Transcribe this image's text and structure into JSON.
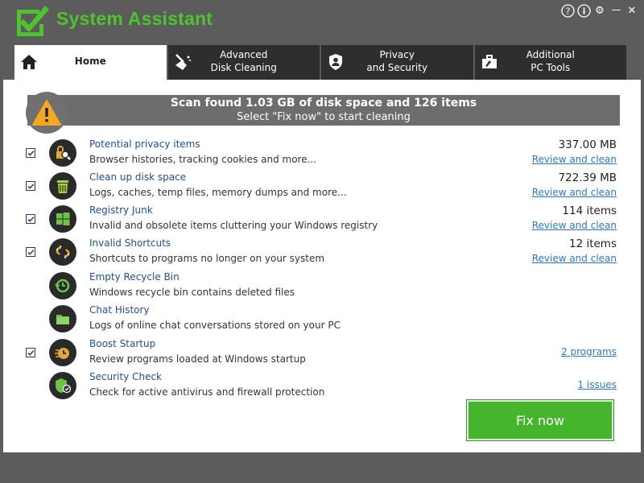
{
  "app": {
    "title": "System Assistant"
  },
  "window_controls": [
    {
      "name": "help-icon",
      "glyph": "?"
    },
    {
      "name": "info-icon",
      "glyph": "i"
    },
    {
      "name": "gear-icon",
      "glyph": "⚙"
    },
    {
      "name": "minimize-icon",
      "glyph": "—"
    },
    {
      "name": "close-icon",
      "glyph": "✕"
    }
  ],
  "tabs": [
    {
      "icon": "home-icon",
      "line1": "Home",
      "line2": "",
      "active": true
    },
    {
      "icon": "broom-icon",
      "line1": "Advanced",
      "line2": "Disk Cleaning",
      "active": false
    },
    {
      "icon": "shield-person-icon",
      "line1": "Privacy",
      "line2": "and Security",
      "active": false
    },
    {
      "icon": "toolbox-icon",
      "line1": "Additional",
      "line2": "PC Tools",
      "active": false
    }
  ],
  "banner": {
    "title": "Scan found 1.03 GB of disk space and 126 items",
    "subtitle": "Select \"Fix now\" to start cleaning"
  },
  "items": [
    {
      "title": "Potential privacy items",
      "desc": "Browser histories, tracking cookies and more...",
      "value": "337.00 MB",
      "link": "Review and clean",
      "checked": true,
      "icon": "padlock-magnifier-icon"
    },
    {
      "title": "Clean up disk space",
      "desc": "Logs, caches, temp files, memory dumps and more...",
      "value": "722.39 MB",
      "link": "Review and clean",
      "checked": true,
      "icon": "trash-bin-icon"
    },
    {
      "title": "Registry Junk",
      "desc": "Invalid and obsolete items cluttering your Windows registry",
      "value": "114 items",
      "link": "Review and clean",
      "checked": true,
      "icon": "windows-icon"
    },
    {
      "title": "Invalid Shortcuts",
      "desc": "Shortcuts to programs no longer on your system",
      "value": "12 items",
      "link": "Review and clean",
      "checked": true,
      "icon": "broken-link-icon"
    },
    {
      "title": "Empty Recycle Bin",
      "desc": "Windows recycle bin contains deleted files",
      "value": "",
      "link": "",
      "checked": false,
      "icon": "recycle-clock-icon"
    },
    {
      "title": "Chat History",
      "desc": "Logs of online chat conversations stored on your PC",
      "value": "",
      "link": "",
      "checked": false,
      "icon": "chat-folder-icon"
    },
    {
      "title": "Boost Startup",
      "desc": "Review programs loaded at Windows startup",
      "value": "",
      "link": "2 programs",
      "checked": true,
      "icon": "speed-clock-icon"
    },
    {
      "title": "Security Check",
      "desc": "Check for active antivirus and firewall protection",
      "value": "",
      "link": "1 issues",
      "checked": false,
      "icon": "security-shield-icon"
    }
  ],
  "fix_button": {
    "label": "Fix now"
  },
  "colors": {
    "accent_green": "#44b52d",
    "title_green": "#4fc32f",
    "link_blue": "#2e77c9",
    "warning_orange": "#f5a623"
  }
}
